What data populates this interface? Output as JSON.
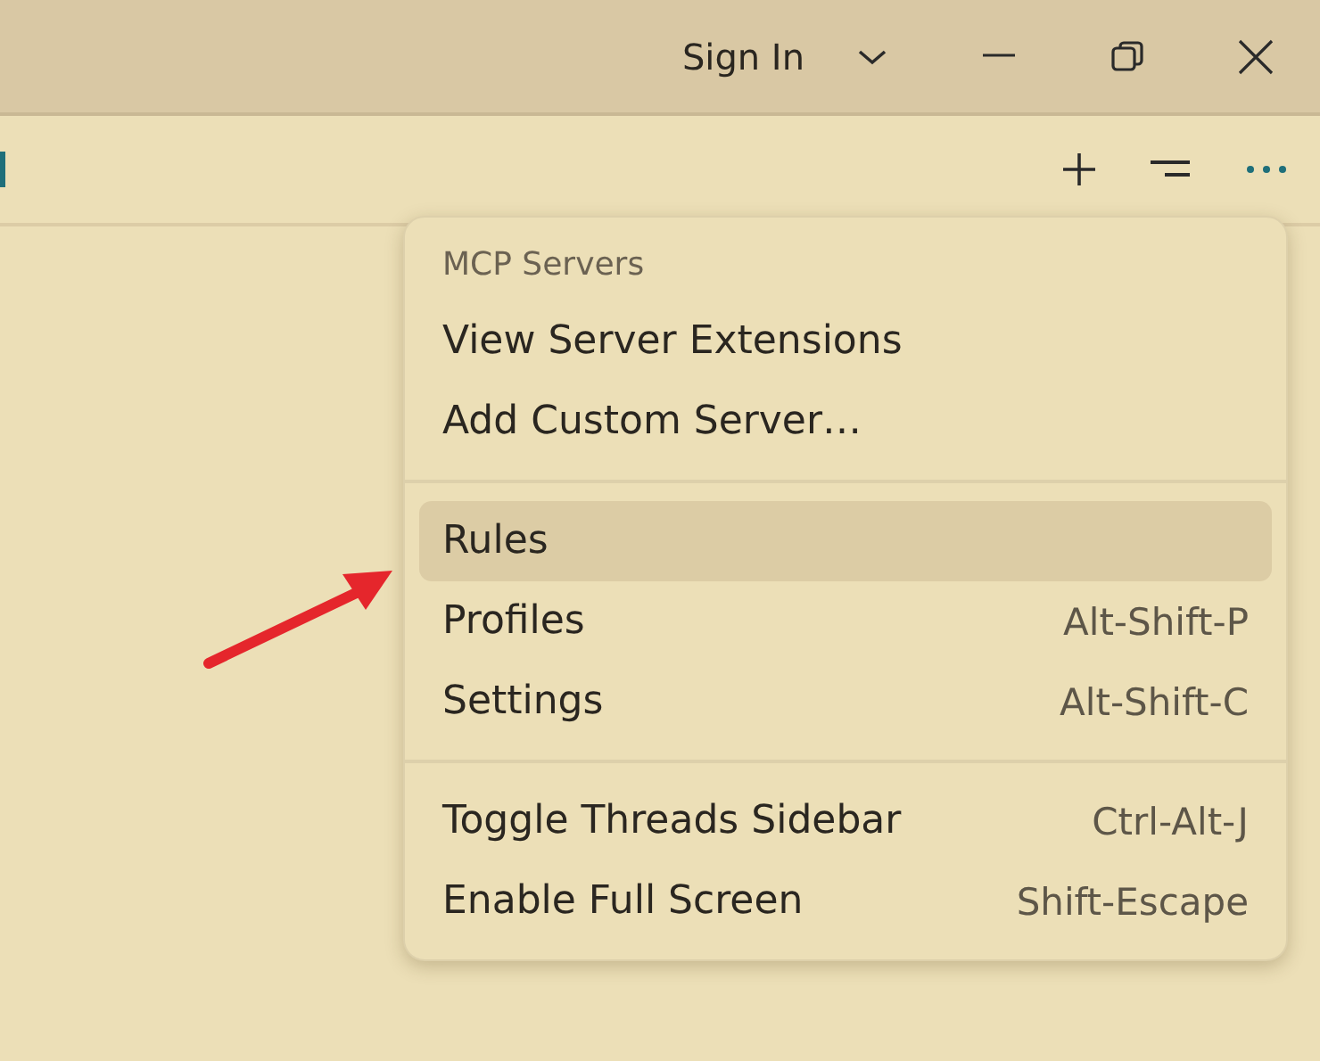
{
  "title_bar": {
    "account_button": "Sign In"
  },
  "menu": {
    "sections": [
      {
        "header": "MCP Servers",
        "items": [
          {
            "label": "View Server Extensions",
            "selected": false
          },
          {
            "label": "Add Custom Server…",
            "selected": false
          }
        ]
      },
      {
        "items": [
          {
            "label": "Rules",
            "selected": true
          },
          {
            "label": "Profiles",
            "shortcut": "Alt-Shift-P",
            "selected": false
          },
          {
            "label": "Settings",
            "shortcut": "Alt-Shift-C",
            "selected": false
          }
        ]
      },
      {
        "items": [
          {
            "label": "Toggle Threads Sidebar",
            "shortcut": "Ctrl-Alt-J",
            "selected": false
          },
          {
            "label": "Enable Full Screen",
            "shortcut": "Shift-Escape",
            "selected": false
          }
        ]
      }
    ]
  }
}
